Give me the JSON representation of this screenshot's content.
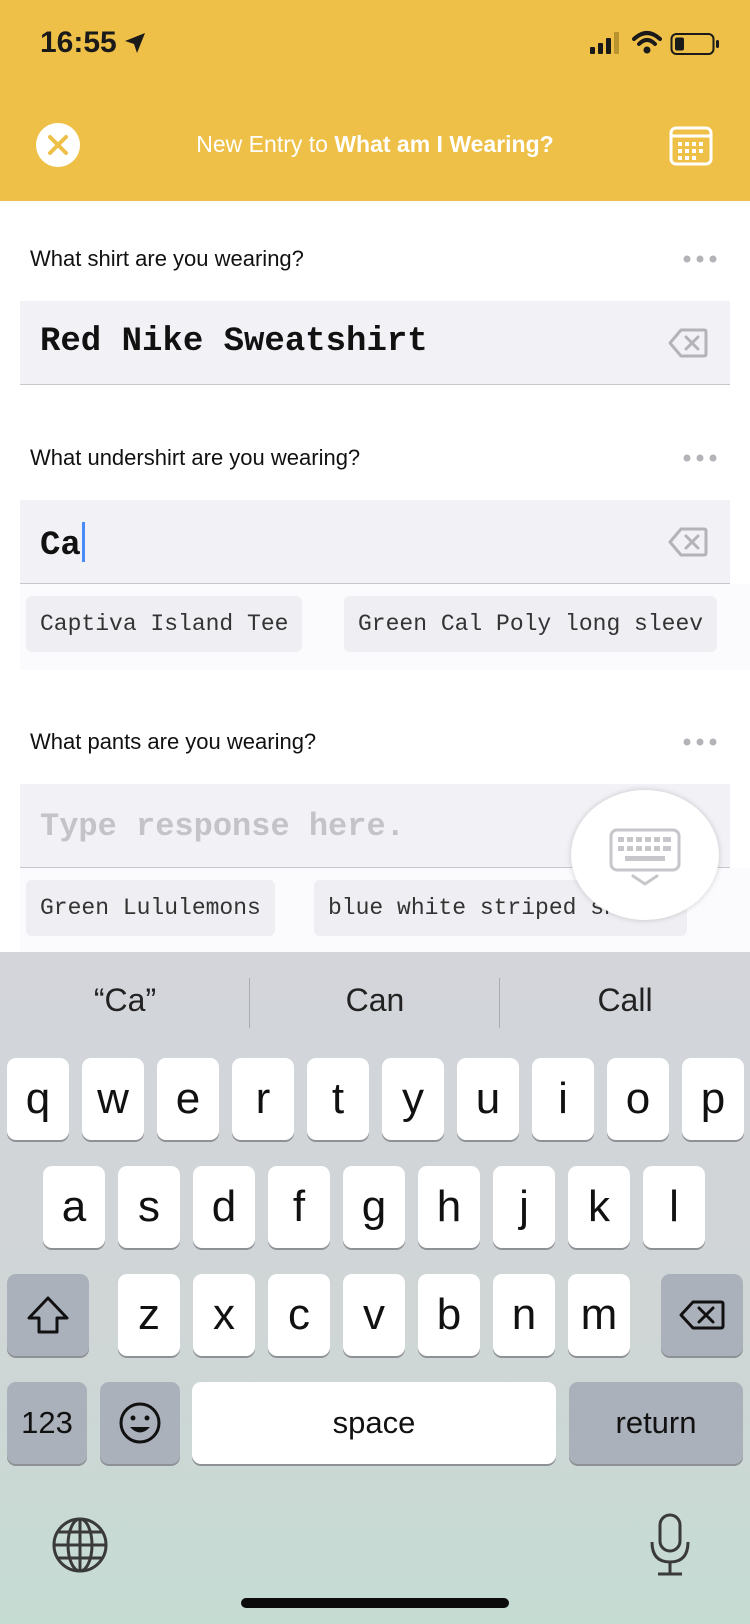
{
  "status_bar": {
    "time": "16:55"
  },
  "header": {
    "title_prefix": "New Entry to ",
    "title_journal": "What am I Wearing?",
    "background_color": "#eec048"
  },
  "questions": [
    {
      "label": "What shirt are you wearing?",
      "value": "Red Nike Sweatshirt",
      "placeholder": "",
      "suggestions": []
    },
    {
      "label": "What undershirt are you wearing?",
      "value": "Ca",
      "placeholder": "",
      "suggestions": [
        "Captiva Island Tee",
        "Green Cal Poly long sleev"
      ]
    },
    {
      "label": "What pants are you wearing?",
      "value": "",
      "placeholder": "Type response here.",
      "suggestions": [
        "Green Lululemons",
        "blue white striped shorts"
      ]
    }
  ],
  "keyboard": {
    "predictions": [
      "“Ca”",
      "Can",
      "Call"
    ],
    "row1": [
      "q",
      "w",
      "e",
      "r",
      "t",
      "y",
      "u",
      "i",
      "o",
      "p"
    ],
    "row2": [
      "a",
      "s",
      "d",
      "f",
      "g",
      "h",
      "j",
      "k",
      "l"
    ],
    "row3": [
      "z",
      "x",
      "c",
      "v",
      "b",
      "n",
      "m"
    ],
    "numbers_label": "123",
    "space_label": "space",
    "return_label": "return"
  }
}
